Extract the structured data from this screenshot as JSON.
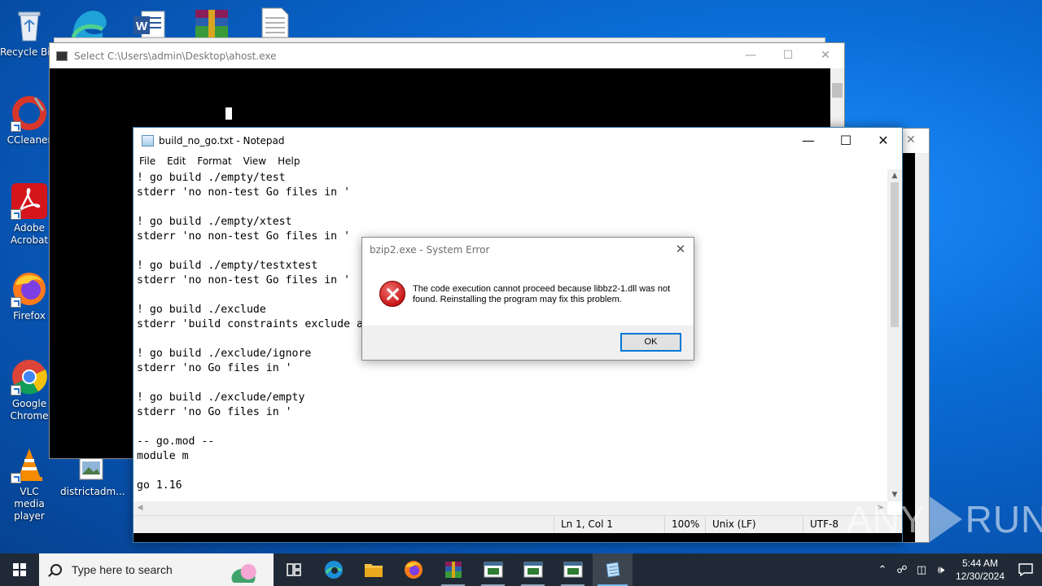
{
  "desktop": {
    "icons": [
      {
        "label": "Recycle Bin"
      },
      {
        "label": "CCleaner"
      },
      {
        "label": "Adobe Acrobat"
      },
      {
        "label": "Firefox"
      },
      {
        "label": "Google Chrome"
      },
      {
        "label": "VLC media player"
      },
      {
        "label": "districtadm..."
      }
    ]
  },
  "console": {
    "title": "Select C:\\Users\\admin\\Desktop\\ahost.exe"
  },
  "notepad": {
    "title": "build_no_go.txt - Notepad",
    "menu": [
      "File",
      "Edit",
      "Format",
      "View",
      "Help"
    ],
    "lines": [
      "! go build ./empty/test",
      "stderr 'no non-test Go files in '",
      "",
      "! go build ./empty/xtest",
      "stderr 'no non-test Go files in '",
      "",
      "! go build ./empty/testxtest",
      "stderr 'no non-test Go files in '",
      "",
      "! go build ./exclude",
      "stderr 'build constraints exclude a",
      "",
      "! go build ./exclude/ignore",
      "stderr 'no Go files in '",
      "",
      "! go build ./exclude/empty",
      "stderr 'no Go files in '",
      "",
      "-- go.mod --",
      "module m",
      "",
      "go 1.16"
    ],
    "status": {
      "position": "Ln 1, Col 1",
      "zoom": "100%",
      "line_ending": "Unix (LF)",
      "encoding": "UTF-8"
    }
  },
  "dialog": {
    "title": "bzip2.exe - System Error",
    "message": "The code execution cannot proceed because libbz2-1.dll was not found. Reinstalling the program may fix this problem.",
    "ok_label": "OK"
  },
  "watermark": {
    "left": "ANY",
    "right": "RUN"
  },
  "taskbar": {
    "search_placeholder": "Type here to search",
    "time": "5:44 AM",
    "date": "12/30/2024"
  },
  "colors": {
    "accent": "#0078d7",
    "error": "#c81818",
    "taskbar": "#202a36"
  }
}
